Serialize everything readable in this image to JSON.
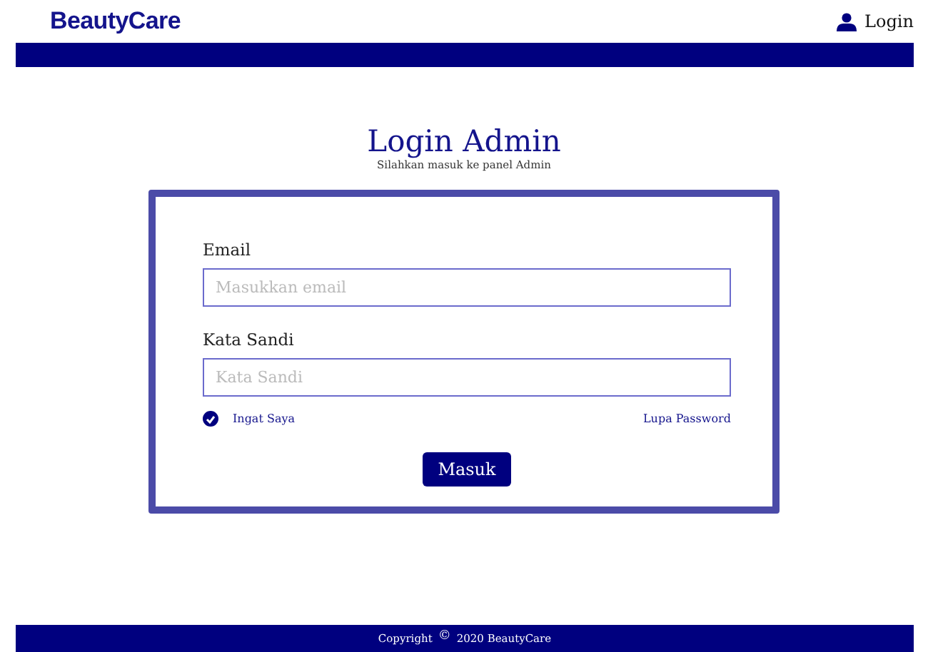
{
  "header": {
    "brand": "BeautyCare",
    "login_link": "Login"
  },
  "page": {
    "title": "Login Admin",
    "subtitle": "Silahkan masuk ke panel Admin"
  },
  "form": {
    "fields": [
      {
        "label": "Email",
        "placeholder": "Masukkan email"
      },
      {
        "label": "Kata Sandi",
        "placeholder": "Kata Sandi"
      }
    ],
    "remember": {
      "label": "Ingat Saya",
      "checked": true
    },
    "forgot_link": "Lupa Password",
    "submit": "Masuk"
  },
  "footer": {
    "prefix": "Copyright",
    "symbol": "©",
    "text": "2020 BeautyCare"
  }
}
